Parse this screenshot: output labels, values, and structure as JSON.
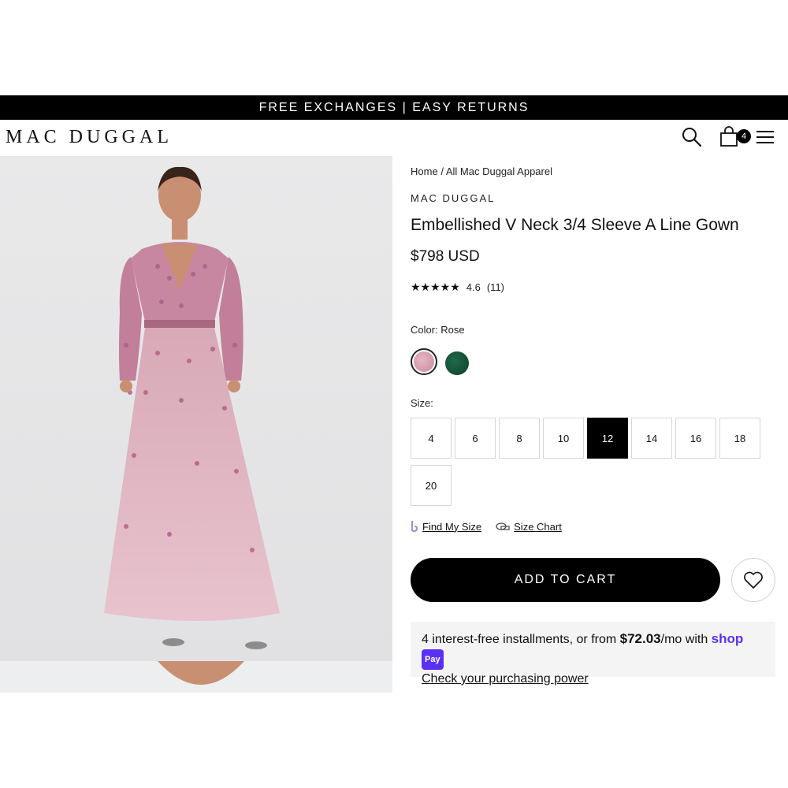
{
  "announcement": "FREE EXCHANGES | EASY RETURNS",
  "header": {
    "logo": "MAC DUGGAL",
    "cart_count": "4",
    "icons": [
      "search-icon",
      "bag-icon",
      "menu-icon"
    ]
  },
  "breadcrumb": {
    "home": "Home",
    "sep": "/",
    "category": "All Mac Duggal Apparel"
  },
  "product": {
    "brand": "MAC DUGGAL",
    "title": "Embellished V Neck 3/4 Sleeve A Line Gown",
    "price": "$798 USD",
    "rating_stars": "★★★★★",
    "rating_value": "4.6",
    "rating_count": "(11)",
    "color_label": "Color: Rose",
    "colors": {
      "rose": "#d9a3b4",
      "green": "#134d34"
    },
    "size_label": "Size:",
    "sizes": [
      "4",
      "6",
      "8",
      "10",
      "12",
      "14",
      "16",
      "18",
      "20"
    ],
    "selected_size": "12",
    "find_my_size": "Find My Size",
    "size_chart": "Size Chart",
    "add_to_cart": "ADD TO CART"
  },
  "shoppay": {
    "text_before": "4 interest-free installments, or from ",
    "amount": "$72.03",
    "text_after": "/mo with ",
    "brand": "shop",
    "badge": "Pay",
    "link": "Check your purchasing power"
  },
  "colors": {
    "shoppay_purple": "#5a31f4",
    "dress_pink": "#d9a3b4"
  }
}
